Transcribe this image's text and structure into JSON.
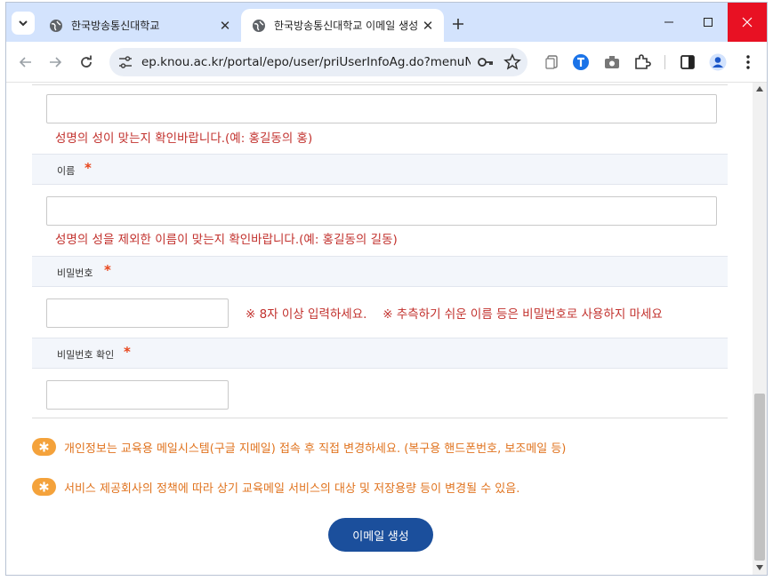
{
  "browser": {
    "tabs": [
      {
        "title": "한국방송통신대학교",
        "active": false
      },
      {
        "title": "한국방송통신대학교 이메일 생성",
        "active": true
      }
    ],
    "url": "ep.knou.ac.kr/portal/epo/user/priUserInfoAg.do?menuNo=..."
  },
  "form": {
    "surname_hint": "성명의 성이 맞는지 확인바랍니다.(예: 홍길동의 홍)",
    "name_label": "이름",
    "required_mark": "*",
    "name_hint": "성명의 성을 제외한 이름이 맞는지 확인바랍니다.(예: 홍길동의 길동)",
    "password_label": "비밀번호",
    "password_hint": "※ 8자 이상 입력하세요.　 ※ 추측하기 쉬운 이름 등은 비밀번호로 사용하지 마세요",
    "password_confirm_label": "비밀번호 확인"
  },
  "notices": [
    "개인정보는 교육용 메일시스템(구글 지메일) 접속 후 직접 변경하세요. (복구용 핸드폰번호, 보조메일 등)",
    "서비스 제공회사의 정책에 따라 상기 교육메일 서비스의 대상 및 저장용량 등이 변경될 수 있음."
  ],
  "submit_label": "이메일 생성",
  "colors": {
    "tabstrip": "#d3e3fd",
    "hint_red": "#c2312d",
    "required_orange": "#e8451b",
    "notice_orange": "#e0731e",
    "button_blue": "#1b4f9c",
    "close_red": "#e81123"
  }
}
